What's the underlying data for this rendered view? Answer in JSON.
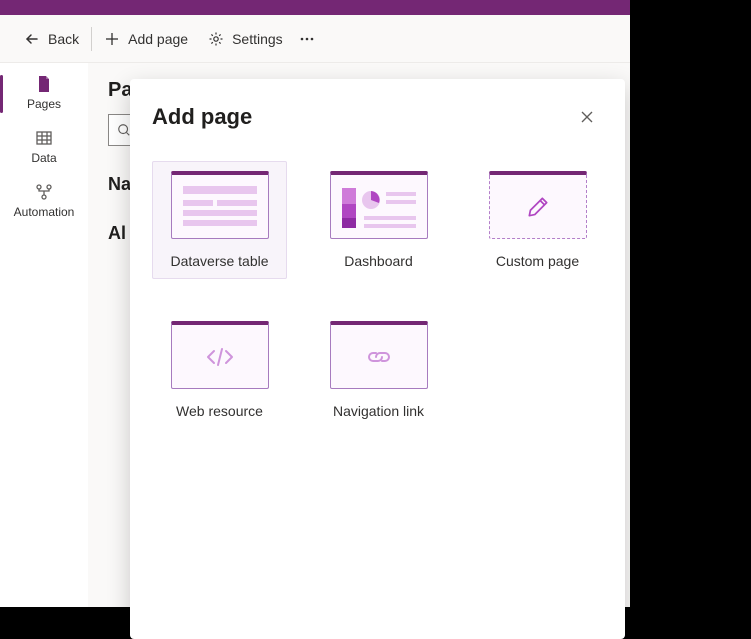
{
  "colors": {
    "brand": "#742774",
    "accent": "#b37fc9"
  },
  "cmdbar": {
    "back": "Back",
    "add_page": "Add page",
    "settings": "Settings"
  },
  "rail": {
    "pages": "Pages",
    "data": "Data",
    "automation": "Automation"
  },
  "content": {
    "heading_prefix": "Pa",
    "nav_prefix": "Na",
    "all_prefix": "Al"
  },
  "modal": {
    "title": "Add page",
    "tiles": {
      "dataverse": "Dataverse table",
      "dashboard": "Dashboard",
      "custom": "Custom page",
      "webres": "Web resource",
      "navlink": "Navigation link"
    }
  }
}
